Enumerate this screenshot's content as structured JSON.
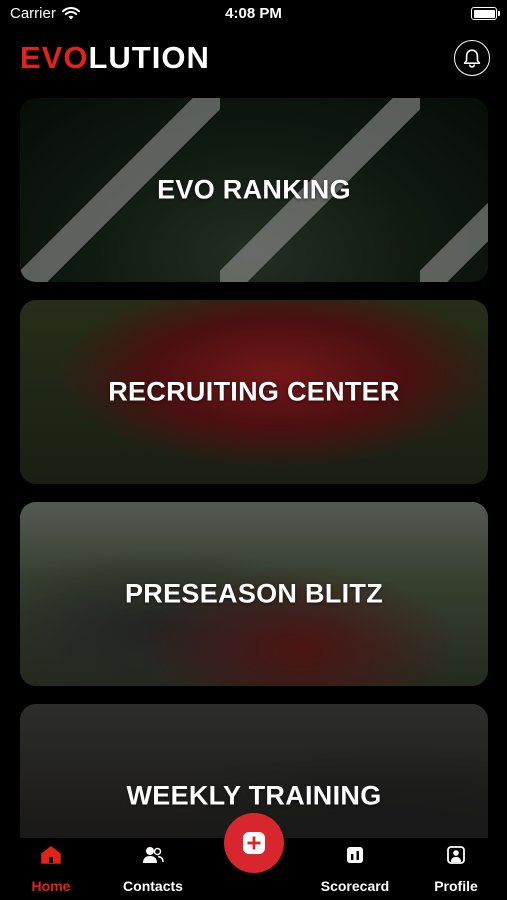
{
  "status_bar": {
    "carrier": "Carrier",
    "time": "4:08 PM",
    "icons": [
      "wifi-icon",
      "battery-icon"
    ]
  },
  "header": {
    "logo_part_red": "EVO",
    "logo_part_white": "LUTION",
    "notification_icon": "bell-icon"
  },
  "cards": [
    {
      "title": "EVO RANKING"
    },
    {
      "title": "RECRUITING CENTER"
    },
    {
      "title": "PRESEASON BLITZ"
    },
    {
      "title": "WEEKLY TRAINING"
    }
  ],
  "bottom_nav": {
    "items": [
      {
        "label": "Home",
        "icon": "home-icon",
        "active": true
      },
      {
        "label": "Contacts",
        "icon": "contacts-icon",
        "active": false
      },
      {
        "label": "Scorecard",
        "icon": "scorecard-icon",
        "active": false
      },
      {
        "label": "Profile",
        "icon": "profile-icon",
        "active": false
      }
    ],
    "fab_icon": "plus-icon"
  },
  "colors": {
    "accent": "#e2231a",
    "fab": "#d7262d",
    "background": "#000000",
    "text": "#ffffff"
  }
}
